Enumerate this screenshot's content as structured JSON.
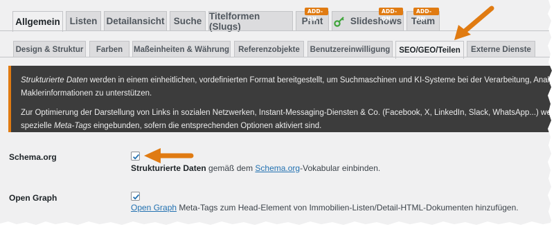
{
  "tabs_primary": [
    {
      "label": "Allgemein",
      "active": true
    },
    {
      "label": "Listen"
    },
    {
      "label": "Detailansicht"
    },
    {
      "label": "Suche"
    },
    {
      "label": "Titelformen (Slugs)"
    },
    {
      "label": "Print",
      "badge": "ADD-ON"
    },
    {
      "label": "Slideshows",
      "badge": "ADD-ON",
      "icon": "key-icon"
    },
    {
      "label": "Team",
      "badge": "ADD-ON"
    }
  ],
  "tabs_secondary": [
    {
      "label": "Design & Struktur"
    },
    {
      "label": "Farben"
    },
    {
      "label": "Maßeinheiten & Währung"
    },
    {
      "label": "Referenzobjekte"
    },
    {
      "label": "Benutzereinwilligung"
    },
    {
      "label": "SEO/GEO/Teilen",
      "active": true
    },
    {
      "label": "Externe Dienste"
    }
  ],
  "notice": {
    "p1_em": "Strukturierte Daten",
    "p1_rest": " werden in einem einheitlichen, vordefinierten Format bereitgestellt, um Suchmaschinen und KI-Systeme bei der Verarbeitung, Analyse und",
    "p1_line2": "Maklerinformationen zu unterstützen.",
    "p2_line1": "Zur Optimierung der Darstellung von Links in sozialen Netzwerken, Instant-Messaging-Diensten & Co. (Facebook, X, LinkedIn, Slack, WhatsApp...) werden in",
    "p2_pre": "spezielle ",
    "p2_em": "Meta-Tags",
    "p2_post": " eingebunden, sofern die entsprechenden Optionen aktiviert sind."
  },
  "schema_org": {
    "label": "Schema.org",
    "checked": true,
    "desc_bold": "Strukturierte Daten",
    "desc_mid": " gemäß dem ",
    "desc_link": "Schema.org",
    "desc_end": "-Vokabular einbinden."
  },
  "open_graph": {
    "label": "Open Graph",
    "checked": true,
    "desc_link": "Open Graph",
    "desc_end": " Meta-Tags zum Head-Element von Immobilien-Listen/Detail-HTML-Dokumenten hinzufügen."
  },
  "colors": {
    "accent_orange": "#e07b12",
    "link_blue": "#2271b1",
    "notice_bg": "#3c3c3c",
    "checkbox_check": "#2271b1"
  }
}
